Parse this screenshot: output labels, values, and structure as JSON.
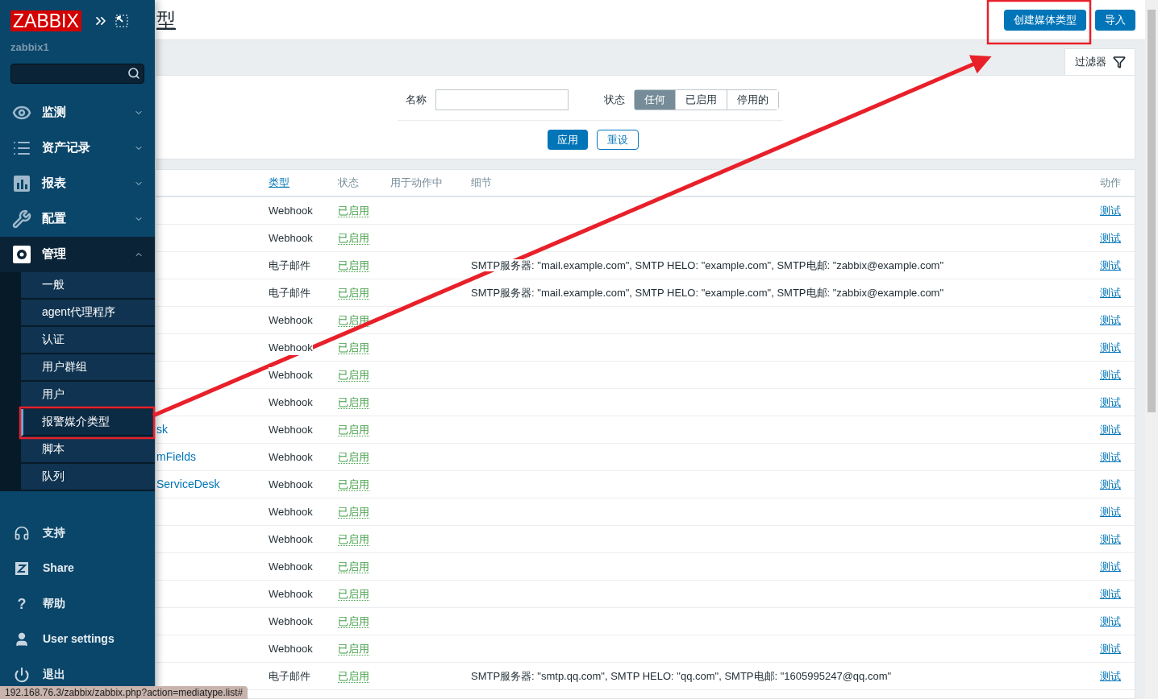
{
  "sidebar": {
    "logo": "ZABBIX",
    "server": "zabbix1",
    "menu": [
      {
        "label": "监测",
        "expanded": false
      },
      {
        "label": "资产记录",
        "expanded": false
      },
      {
        "label": "报表",
        "expanded": false
      },
      {
        "label": "配置",
        "expanded": false
      },
      {
        "label": "管理",
        "expanded": true,
        "children": [
          {
            "label": "一般",
            "selected": false
          },
          {
            "label": "agent代理程序",
            "selected": false
          },
          {
            "label": "认证",
            "selected": false
          },
          {
            "label": "用户群组",
            "selected": false
          },
          {
            "label": "用户",
            "selected": false
          },
          {
            "label": "报警媒介类型",
            "selected": true
          },
          {
            "label": "脚本",
            "selected": false
          },
          {
            "label": "队列",
            "selected": false
          }
        ]
      }
    ],
    "footer": [
      {
        "label": "支持"
      },
      {
        "label": "Share"
      },
      {
        "label": "帮助",
        "icon_text": "?"
      },
      {
        "label": "User settings"
      },
      {
        "label": "退出"
      }
    ]
  },
  "header": {
    "title": "型",
    "buttons": [
      "创建媒体类型",
      "导入"
    ]
  },
  "filter": {
    "tab": "过滤器",
    "name_label": "名称",
    "status_label": "状态",
    "status_options": [
      {
        "label": "任何",
        "selected": true
      },
      {
        "label": "已启用",
        "selected": false
      },
      {
        "label": "停用的",
        "selected": false
      }
    ],
    "apply": "应用",
    "reset": "重设"
  },
  "table": {
    "columns": [
      "类型",
      "状态",
      "用于动作中",
      "细节",
      "动作"
    ],
    "rows": [
      {
        "type": "Webhook",
        "status": "已启用",
        "enabled": true,
        "action": "测试"
      },
      {
        "type": "Webhook",
        "status": "已启用",
        "enabled": true,
        "action": "测试"
      },
      {
        "type": "电子邮件",
        "status": "已启用",
        "enabled": true,
        "details": "SMTP服务器: \"mail.example.com\", SMTP HELO: \"example.com\", SMTP电邮: \"zabbix@example.com\"",
        "action": "测试"
      },
      {
        "type": "电子邮件",
        "status": "已启用",
        "enabled": true,
        "details": "SMTP服务器: \"mail.example.com\", SMTP HELO: \"example.com\", SMTP电邮: \"zabbix@example.com\"",
        "action": "测试"
      },
      {
        "type": "Webhook",
        "status": "已启用",
        "enabled": true,
        "action": "测试"
      },
      {
        "type": "Webhook",
        "status": "已启用",
        "enabled": true,
        "action": "测试"
      },
      {
        "type": "Webhook",
        "status": "已启用",
        "enabled": true,
        "action": "测试"
      },
      {
        "type": "Webhook",
        "status": "已启用",
        "enabled": true,
        "action": "测试"
      },
      {
        "name": "sk",
        "type": "Webhook",
        "status": "已启用",
        "enabled": true,
        "action": "测试"
      },
      {
        "name": "mFields",
        "type": "Webhook",
        "status": "已启用",
        "enabled": true,
        "action": "测试"
      },
      {
        "name": "ServiceDesk",
        "type": "Webhook",
        "status": "已启用",
        "enabled": true,
        "action": "测试"
      },
      {
        "type": "Webhook",
        "status": "已启用",
        "enabled": true,
        "action": "测试"
      },
      {
        "type": "Webhook",
        "status": "已启用",
        "enabled": true,
        "action": "测试"
      },
      {
        "type": "Webhook",
        "status": "已启用",
        "enabled": true,
        "action": "测试"
      },
      {
        "type": "Webhook",
        "status": "已启用",
        "enabled": true,
        "action": "测试"
      },
      {
        "type": "Webhook",
        "status": "已启用",
        "enabled": true,
        "action": "测试"
      },
      {
        "type": "Webhook",
        "status": "已启用",
        "enabled": true,
        "action": "测试"
      },
      {
        "type": "电子邮件",
        "status": "已启用",
        "enabled": true,
        "details": "SMTP服务器: \"smtp.qq.com\", SMTP HELO: \"qq.com\", SMTP电邮: \"1605995247@qq.com\"",
        "action": "测试"
      }
    ]
  },
  "status_bar": "192.168.76.3/zabbix/zabbix.php?action=mediatype.list#"
}
